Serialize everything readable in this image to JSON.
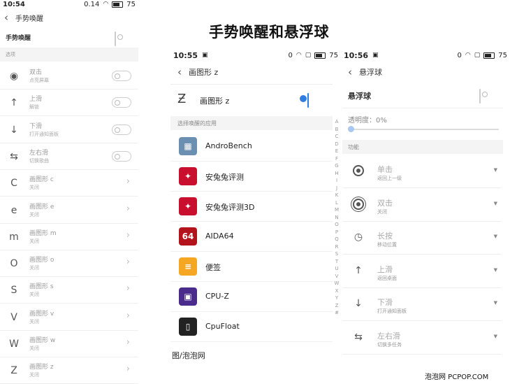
{
  "headline": "手势唤醒和悬浮球",
  "watermark": "图/泡泡网",
  "footer_brand": "泡泡网 PCPOP.COM",
  "left_panel": {
    "status": {
      "time": "10:54",
      "signal": "0.14",
      "battery": "75"
    },
    "title": "手势唤醒",
    "main_label": "手势唤醒",
    "section": "选项",
    "rows": [
      {
        "title": "双击",
        "sub": "点亮屏幕",
        "control": "toggle",
        "icon": "double-tap-icon",
        "glyph": "◉"
      },
      {
        "title": "上滑",
        "sub": "解锁",
        "control": "toggle",
        "icon": "swipe-up-icon",
        "glyph": "↑"
      },
      {
        "title": "下滑",
        "sub": "打开通知面板",
        "control": "toggle",
        "icon": "swipe-down-icon",
        "glyph": "↓"
      },
      {
        "title": "左右滑",
        "sub": "切换歌曲",
        "control": "toggle",
        "icon": "swipe-left-right-icon",
        "glyph": "⇆"
      },
      {
        "title": "画图形 c",
        "sub": "关闭",
        "control": "chevron",
        "icon": "gesture-c-icon",
        "glyph": "C"
      },
      {
        "title": "画图形 e",
        "sub": "关闭",
        "control": "chevron",
        "icon": "gesture-e-icon",
        "glyph": "e"
      },
      {
        "title": "画图形 m",
        "sub": "关闭",
        "control": "chevron",
        "icon": "gesture-m-icon",
        "glyph": "m"
      },
      {
        "title": "画图形 o",
        "sub": "关闭",
        "control": "chevron",
        "icon": "gesture-o-icon",
        "glyph": "O"
      },
      {
        "title": "画图形 s",
        "sub": "关闭",
        "control": "chevron",
        "icon": "gesture-s-icon",
        "glyph": "S"
      },
      {
        "title": "画图形 v",
        "sub": "关闭",
        "control": "chevron",
        "icon": "gesture-v-icon",
        "glyph": "V"
      },
      {
        "title": "画图形 w",
        "sub": "关闭",
        "control": "chevron",
        "icon": "gesture-w-icon",
        "glyph": "W"
      },
      {
        "title": "画图形 z",
        "sub": "关闭",
        "control": "chevron",
        "icon": "gesture-z-icon",
        "glyph": "Z"
      }
    ]
  },
  "middle_panel": {
    "status": {
      "time": "10:55",
      "signal": "0",
      "battery": "75"
    },
    "title": "画图形 z",
    "toggle_label": "画图形 z",
    "section": "选择唤醒的应用",
    "apps": [
      {
        "name": "AndroBench",
        "color": "#6b8fb0",
        "glyph": "▦",
        "icon": "androbench-icon"
      },
      {
        "name": "安兔兔评测",
        "color": "#c8102e",
        "glyph": "✦",
        "icon": "antutu-icon"
      },
      {
        "name": "安兔兔评测3D",
        "color": "#c8102e",
        "glyph": "✦",
        "icon": "antutu-3d-icon"
      },
      {
        "name": "AIDA64",
        "color": "#b3141b",
        "glyph": "64",
        "icon": "aida64-icon"
      },
      {
        "name": "便签",
        "color": "#f5a623",
        "glyph": "≡",
        "icon": "notes-icon"
      },
      {
        "name": "CPU-Z",
        "color": "#4a2a8a",
        "glyph": "▣",
        "icon": "cpuz-icon"
      },
      {
        "name": "CpuFloat",
        "color": "#222222",
        "glyph": "▯",
        "icon": "cpufloat-icon"
      }
    ],
    "alphabet": [
      "A",
      "B",
      "C",
      "D",
      "E",
      "F",
      "G",
      "H",
      "I",
      "J",
      "K",
      "L",
      "M",
      "N",
      "O",
      "P",
      "Q",
      "R",
      "S",
      "T",
      "U",
      "V",
      "W",
      "X",
      "Y",
      "Z",
      "#"
    ]
  },
  "right_panel": {
    "status": {
      "time": "10:56",
      "signal": "0",
      "battery": "75"
    },
    "title": "悬浮球",
    "main_label": "悬浮球",
    "opacity_label": "透明度：0%",
    "opacity_value": 0,
    "section": "功能",
    "rows": [
      {
        "title": "单击",
        "sub": "返回上一级",
        "icon": "single-tap-icon"
      },
      {
        "title": "双击",
        "sub": "关闭",
        "icon": "double-tap-icon"
      },
      {
        "title": "长按",
        "sub": "移动位置",
        "icon": "long-press-icon"
      },
      {
        "title": "上滑",
        "sub": "返回桌面",
        "icon": "swipe-up-icon"
      },
      {
        "title": "下滑",
        "sub": "打开通知面板",
        "icon": "swipe-down-icon"
      },
      {
        "title": "左右滑",
        "sub": "切换多任务",
        "icon": "swipe-left-right-icon"
      }
    ]
  },
  "colors": {
    "accent": "#2f7de1",
    "section_bg": "#f4f4f4"
  }
}
